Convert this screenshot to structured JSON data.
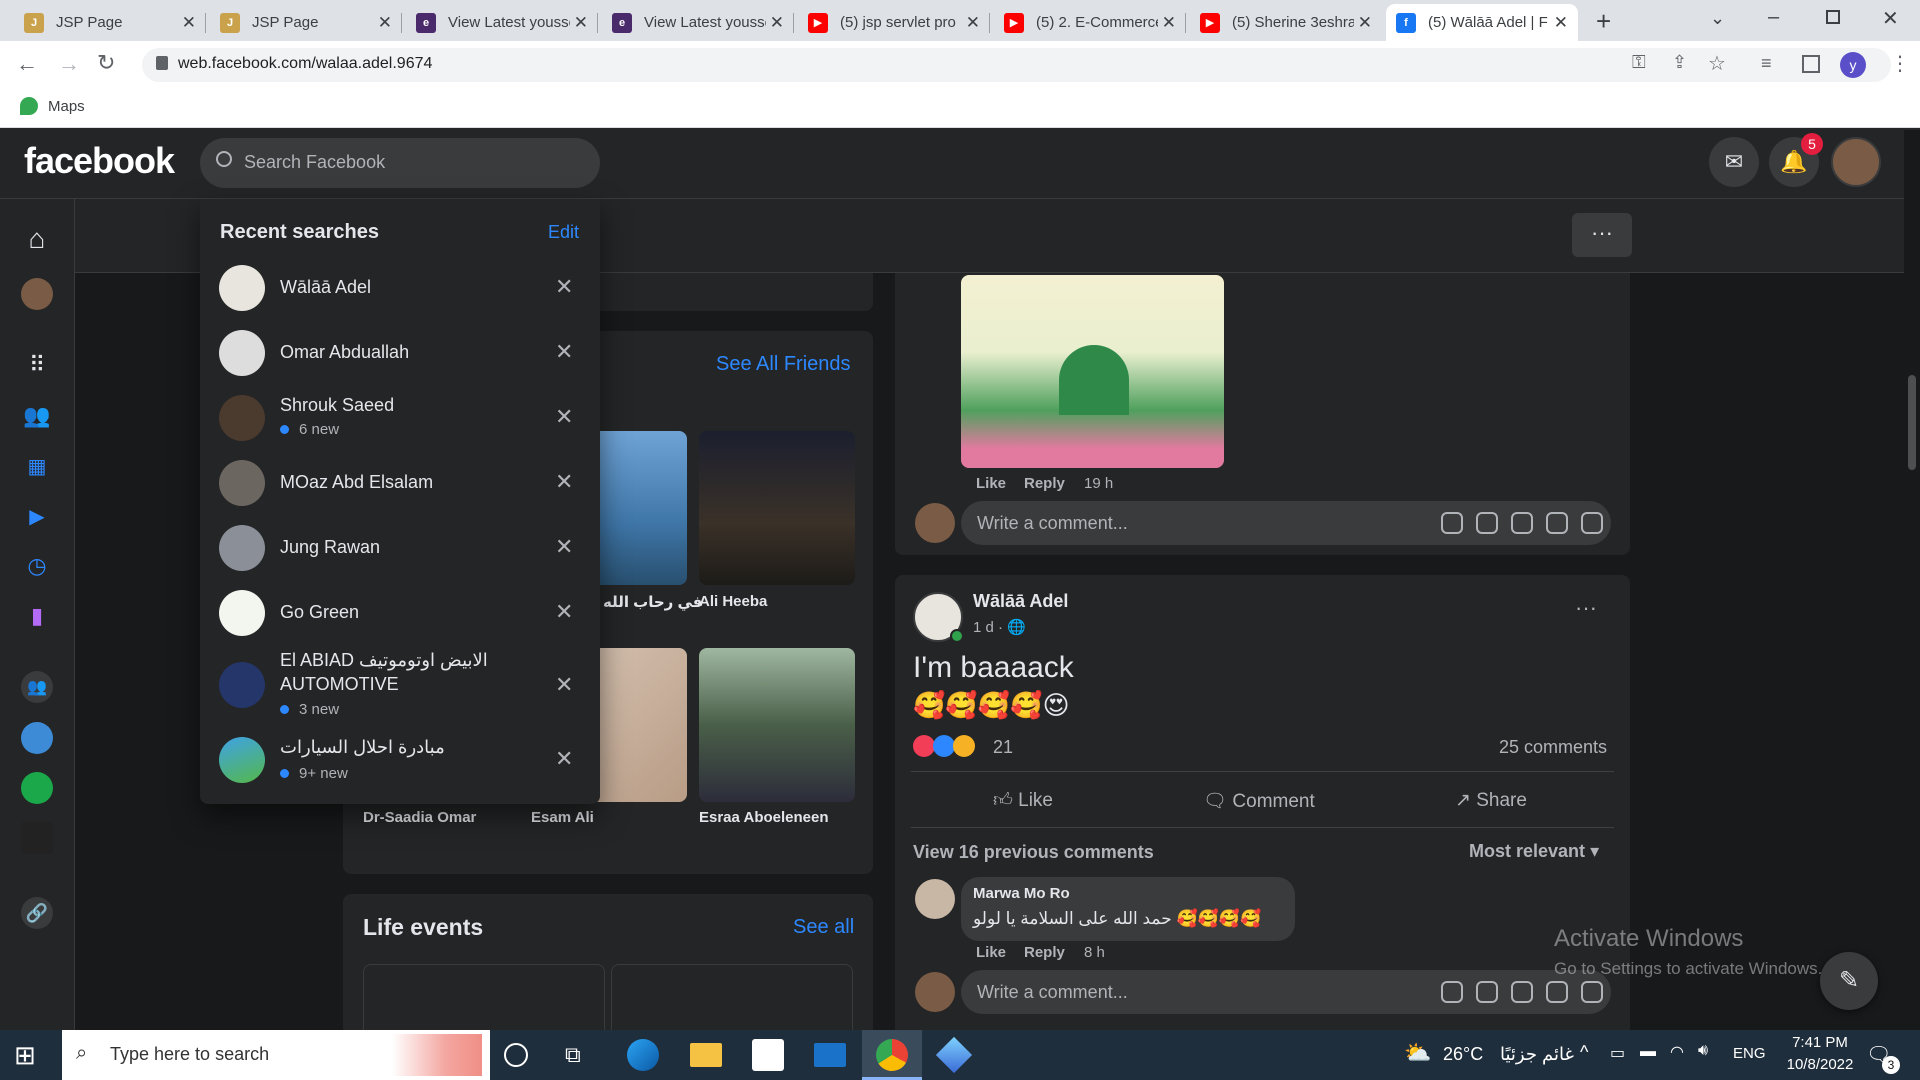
{
  "browser": {
    "tabs": [
      {
        "title": "JSP Page",
        "icon": "jsp-icon"
      },
      {
        "title": "JSP Page",
        "icon": "jsp-icon"
      },
      {
        "title": "View Latest yousse",
        "icon": "eclipse-icon"
      },
      {
        "title": "View Latest yousse",
        "icon": "eclipse-icon"
      },
      {
        "title": "(5) jsp servlet pro",
        "icon": "youtube-icon"
      },
      {
        "title": "(5) 2. E-Commerce",
        "icon": "youtube-icon"
      },
      {
        "title": "(5) Sherine 3eshra",
        "icon": "youtube-icon"
      },
      {
        "title": "(5) Wālāā Adel | F",
        "icon": "facebook-icon"
      }
    ],
    "url": "web.facebook.com/walaa.adel.9674",
    "profile_initial": "y",
    "bookmark": "Maps"
  },
  "fb": {
    "logo": "facebook",
    "search_placeholder": "Search Facebook",
    "notif_count": "5",
    "recent": {
      "title": "Recent searches",
      "edit": "Edit",
      "items": [
        {
          "name": "Wālāā Adel",
          "sub": ""
        },
        {
          "name": "Omar Abduallah",
          "sub": ""
        },
        {
          "name": "Shrouk Saeed",
          "sub": "6 new"
        },
        {
          "name": "MOaz Abd Elsalam",
          "sub": ""
        },
        {
          "name": "Jung Rawan",
          "sub": ""
        },
        {
          "name": "Go Green",
          "sub": ""
        },
        {
          "name": "El ABIAD الابيض اوتوموتيف",
          "name2": "AUTOMOTIVE",
          "sub": "3 new"
        },
        {
          "name": "مبادرة احلال السيارات",
          "sub": "9+ new"
        }
      ]
    },
    "friends": {
      "see_all": "See All Friends",
      "names": [
        "في رحاب الله",
        "Ali Heeba",
        "Dr-Saadia Omar",
        "Esam Ali",
        "Esraa Aboeleneen"
      ]
    },
    "life_events": {
      "title": "Life events",
      "see_all": "See all"
    },
    "post1": {
      "like": "Like",
      "reply": "Reply",
      "time": "19 h",
      "comment_placeholder": "Write a comment..."
    },
    "post2": {
      "author": "Wālāā Adel",
      "time": "1 d",
      "text": "I'm baaaack",
      "emojis": "🥰🥰🥰🥰😍",
      "reaction_count": "21",
      "comments_count": "25 comments",
      "actions": {
        "like": "Like",
        "comment": "Comment",
        "share": "Share"
      },
      "view_prev": "View 16 previous comments",
      "sort": "Most relevant",
      "comment": {
        "author": "Marwa Mo Ro",
        "text": "حمد الله على السلامة يا لولو 🥰🥰🥰🥰",
        "like": "Like",
        "reply": "Reply",
        "time": "8 h"
      },
      "comment_placeholder": "Write a comment..."
    },
    "watermark": {
      "title": "Activate Windows",
      "sub": "Go to Settings to activate Windows."
    }
  },
  "taskbar": {
    "search": "Type here to search",
    "weather": "26°C",
    "weather_text": "غائم جزئيًا",
    "lang": "ENG",
    "time": "7:41 PM",
    "date": "10/8/2022",
    "notif": "3"
  },
  "colors": {
    "fb_bg": "#18191a",
    "fb_surface": "#242526",
    "fb_blue": "#2d88ff",
    "notif_red": "#e41e3f"
  }
}
